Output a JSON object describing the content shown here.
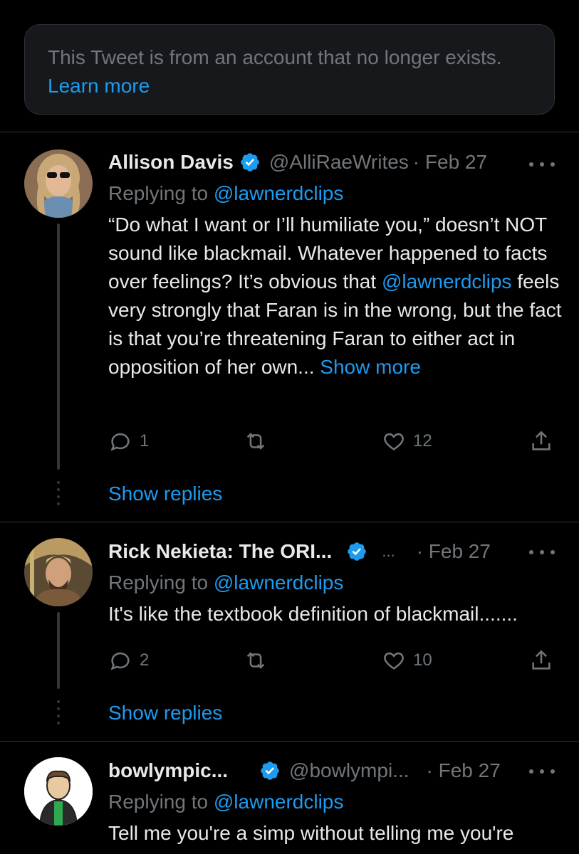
{
  "notice": {
    "text": "This Tweet is from an account that no longer exists.",
    "link": "Learn more"
  },
  "tweets": [
    {
      "name": "Allison Davis",
      "handle": "@AlliRaeWrites",
      "date": "· Feb 27",
      "replying_prefix": "Replying to",
      "replying_to": "@lawnerdclips",
      "text_1": "“Do what I want or I’ll humiliate you,” doesn’t NOT sound like blackmail. Whatever happened to facts over feelings? It’s obvious that",
      "mention": "@lawnerdclips",
      "text_2": " feels very strongly that Faran is in the wrong, but the fact is that you’re threatening Faran to either act in opposition of her own...",
      "show_more": "Show more",
      "replies": "1",
      "retweets": "",
      "likes": "12",
      "show_replies": "Show replies"
    },
    {
      "name": "Rick Nekieta: The ORI...",
      "handle": "...",
      "date": "· Feb 27",
      "replying_prefix": "Replying to",
      "replying_to": "@lawnerdclips",
      "text": "It's like the textbook definition of blackmail.......",
      "replies": "2",
      "retweets": "",
      "likes": "10",
      "show_replies": "Show replies"
    },
    {
      "name": "bowlympic...",
      "handle": "@bowlympi...",
      "date": "· Feb 27",
      "replying_prefix": "Replying to",
      "replying_to": "@lawnerdclips",
      "text": "Tell me you're a simp without telling me you're"
    }
  ],
  "colors": {
    "background": "#000000",
    "text": "#e7e9ea",
    "secondary": "#71767b",
    "link": "#1d9bf0",
    "verified": "#1d9bf0"
  }
}
